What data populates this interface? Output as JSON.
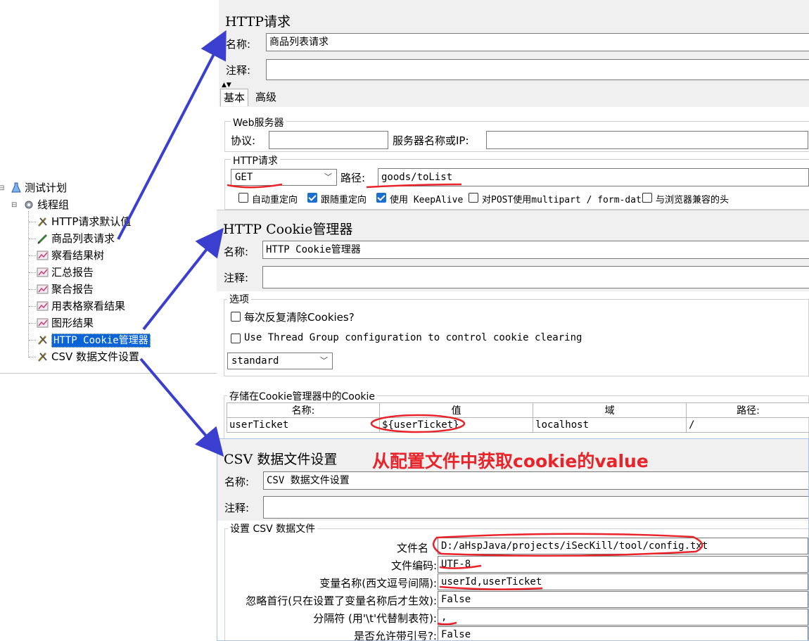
{
  "tree": {
    "root": "测试计划",
    "thread_group": "线程组",
    "items": [
      {
        "label": "HTTP请求默认值",
        "icon": "tools-icon"
      },
      {
        "label": "商品列表请求",
        "icon": "pipette-icon"
      },
      {
        "label": "察看结果树",
        "icon": "chart-icon"
      },
      {
        "label": "汇总报告",
        "icon": "chart-icon"
      },
      {
        "label": "聚合报告",
        "icon": "chart-icon"
      },
      {
        "label": "用表格察看结果",
        "icon": "chart-icon"
      },
      {
        "label": "图形结果",
        "icon": "chart-icon"
      },
      {
        "label": "HTTP Cookie管理器",
        "icon": "tools-icon",
        "selected": true
      },
      {
        "label": "CSV 数据文件设置",
        "icon": "tools-icon"
      }
    ]
  },
  "http_panel": {
    "title": "HTTP请求",
    "name_label": "名称:",
    "name_value": "商品列表请求",
    "comment_label": "注释:",
    "comment_value": "",
    "tabs": [
      "基本",
      "高级"
    ],
    "web_server_label": "Web服务器",
    "protocol_label": "协议:",
    "protocol_value": "",
    "server_label": "服务器名称或IP:",
    "server_value": "",
    "http_request_label": "HTTP请求",
    "method": "GET",
    "path_label": "路径:",
    "path_value": "goods/toList",
    "checkboxes": [
      {
        "label": "自动重定向",
        "checked": false
      },
      {
        "label": "跟随重定向",
        "checked": true
      },
      {
        "label": "使用 KeepAlive",
        "checked": true
      },
      {
        "label": "对POST使用multipart / form-data",
        "checked": false
      },
      {
        "label": "与浏览器兼容的头",
        "checked": false
      }
    ]
  },
  "cookie_panel": {
    "title": "HTTP Cookie管理器",
    "name_label": "名称:",
    "name_value": "HTTP Cookie管理器",
    "comment_label": "注释:",
    "comment_value": "",
    "options_label": "选项",
    "clear_each": "每次反复清除Cookies?",
    "use_thread_group": "Use Thread Group configuration to control cookie clearing",
    "policy": "standard",
    "stored_label": "存储在Cookie管理器中的Cookie",
    "columns": [
      "名称:",
      "值",
      "域",
      "路径:"
    ],
    "rows": [
      {
        "name": "userTicket",
        "value": "${userTicket}",
        "domain": "localhost",
        "path": "/"
      }
    ]
  },
  "csv_panel": {
    "title": "CSV 数据文件设置",
    "annotation": "从配置文件中获取cookie的value",
    "name_label": "名称:",
    "name_value": "CSV 数据文件设置",
    "comment_label": "注释:",
    "comment_value": "",
    "group_label": "设置 CSV 数据文件",
    "fields": [
      {
        "label": "文件名",
        "value": "D:/aHspJava/projects/iSecKill/tool/config.txt"
      },
      {
        "label": "文件编码:",
        "value": "UTF-8"
      },
      {
        "label": "变量名称(西文逗号间隔):",
        "value": "userId,userTicket"
      },
      {
        "label": "忽略首行(只在设置了变量名称后才生效):",
        "value": "False"
      },
      {
        "label": "分隔符 (用'\\t'代替制表符):",
        "value": ","
      },
      {
        "label": "是否允许带引号?:",
        "value": "False"
      }
    ]
  },
  "colors": {
    "arrow": "#3a3fd0",
    "annotation": "#e8242a",
    "selected_bg": "#0a64d8",
    "checkbox_on": "#1a6fd1"
  }
}
